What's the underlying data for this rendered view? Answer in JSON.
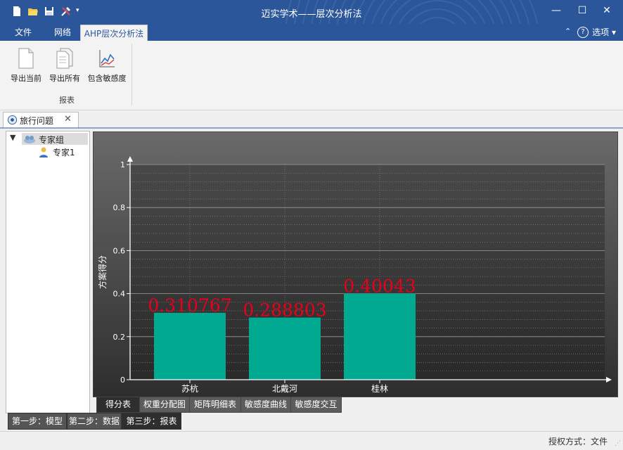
{
  "window": {
    "title": "迈实学术——层次分析法"
  },
  "ribbon": {
    "tabs": [
      "文件",
      "网络",
      "AHP层次分析法"
    ],
    "active_tab": "AHP层次分析法",
    "options_label": "选项",
    "buttons": [
      "导出当前",
      "导出所有",
      "包含敏感度"
    ],
    "group_label": "报表"
  },
  "document": {
    "tab_label": "旅行问题"
  },
  "tree": {
    "root": "专家组",
    "child": "专家1"
  },
  "chart_data": {
    "type": "bar",
    "categories": [
      "苏杭",
      "北戴河",
      "桂林"
    ],
    "values": [
      0.310767,
      0.288803,
      0.40043
    ],
    "data_labels": [
      "0.310767",
      "0.288803",
      "0.40043"
    ],
    "ylabel": "方案得分",
    "ylim": [
      0,
      1
    ],
    "yticks": [
      "0",
      "0.2",
      "0.4",
      "0.6",
      "0.8",
      "1"
    ],
    "bar_color": "#00a98f",
    "label_color": "#e8001c",
    "grid": true
  },
  "chart_tabs": [
    "得分表",
    "权重分配图",
    "矩阵明细表",
    "敏感度曲线",
    "敏感度交互"
  ],
  "active_chart_tab": "得分表",
  "steps": [
    "第一步：模型",
    "第二步：数据",
    "第三步：报表"
  ],
  "active_step": "第三步：报表",
  "status": {
    "text": "授权方式：文件"
  },
  "colors": {
    "title_bar": "#2b579a",
    "bar": "#00a98f",
    "data_label": "#e8001c"
  }
}
